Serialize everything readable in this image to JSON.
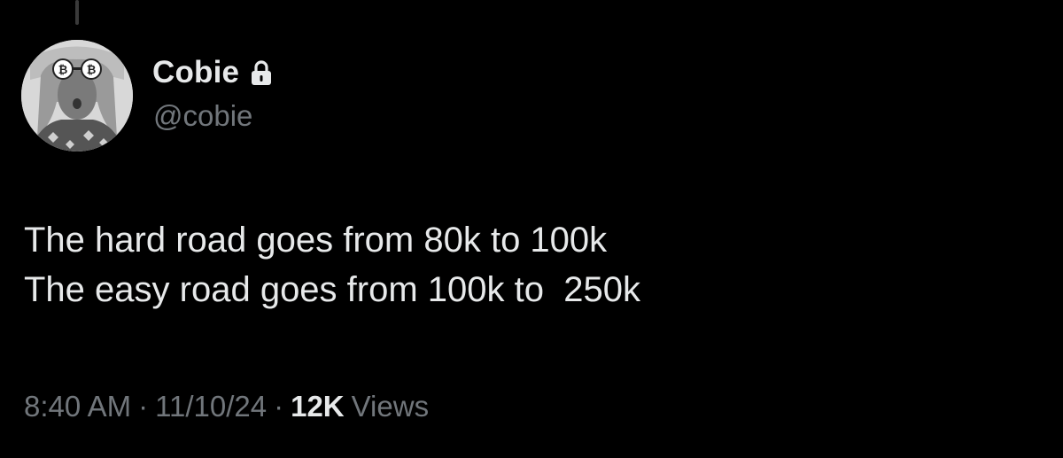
{
  "author": {
    "display_name": "Cobie",
    "handle": "@cobie",
    "avatar_icon": "profile-avatar",
    "badge_icon": "lock-icon"
  },
  "tweet": {
    "lines": [
      "The hard road goes from 80k to 100k",
      "The easy road goes from 100k to  250k"
    ]
  },
  "meta": {
    "time": "8:40 AM",
    "separator": "·",
    "date": "11/10/24",
    "views_count": "12K",
    "views_label": "Views"
  },
  "colors": {
    "background": "#000000",
    "primary_text": "#e7e9ea",
    "secondary_text": "#71767b"
  }
}
